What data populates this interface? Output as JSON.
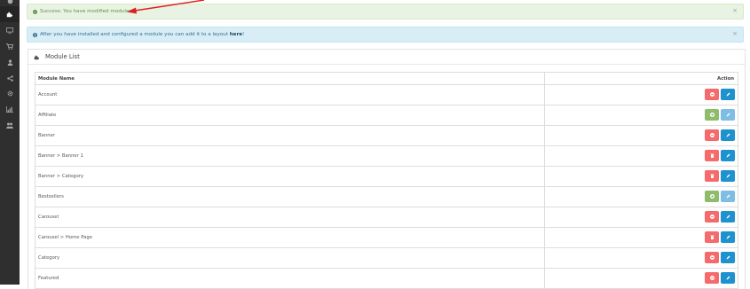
{
  "alerts": {
    "success_text": "Success: You have modified modules!",
    "info_text": "After you have installed and configured a module you can add it to a layout",
    "info_link": "here",
    "info_suffix": "!",
    "close": "×"
  },
  "panel": {
    "title": "Module List"
  },
  "table": {
    "col_name": "Module Name",
    "col_action": "Action",
    "rows": [
      {
        "name": "Account",
        "state": "installed"
      },
      {
        "name": "Affiliate",
        "state": "uninstalled"
      },
      {
        "name": "Banner",
        "state": "installed"
      },
      {
        "name": "Banner > Banner 1",
        "state": "instance"
      },
      {
        "name": "Banner > Category",
        "state": "instance"
      },
      {
        "name": "Bestsellers",
        "state": "uninstalled"
      },
      {
        "name": "Carousel",
        "state": "installed"
      },
      {
        "name": "Carousel > Home Page",
        "state": "instance"
      },
      {
        "name": "Category",
        "state": "installed"
      },
      {
        "name": "Featured",
        "state": "installed"
      }
    ]
  },
  "colors": {
    "sidebar": "#2f2f2f",
    "success_bg": "#e9f3e3",
    "info_bg": "#d9edf7",
    "danger": "#f56b6b",
    "success": "#8fbb6c",
    "primary": "#1e91cf",
    "primary_disabled": "#7fbde4",
    "arrow": "#e02020"
  },
  "icons": {
    "sidebar": [
      "dashboard-icon",
      "puzzle-icon",
      "desktop-icon",
      "cart-icon",
      "user-icon",
      "share-icon",
      "gear-icon",
      "chart-icon",
      "users-icon"
    ],
    "uninstall": "minus-circle-icon",
    "install": "plus-circle-icon",
    "delete": "trash-icon",
    "edit": "pencil-icon"
  }
}
